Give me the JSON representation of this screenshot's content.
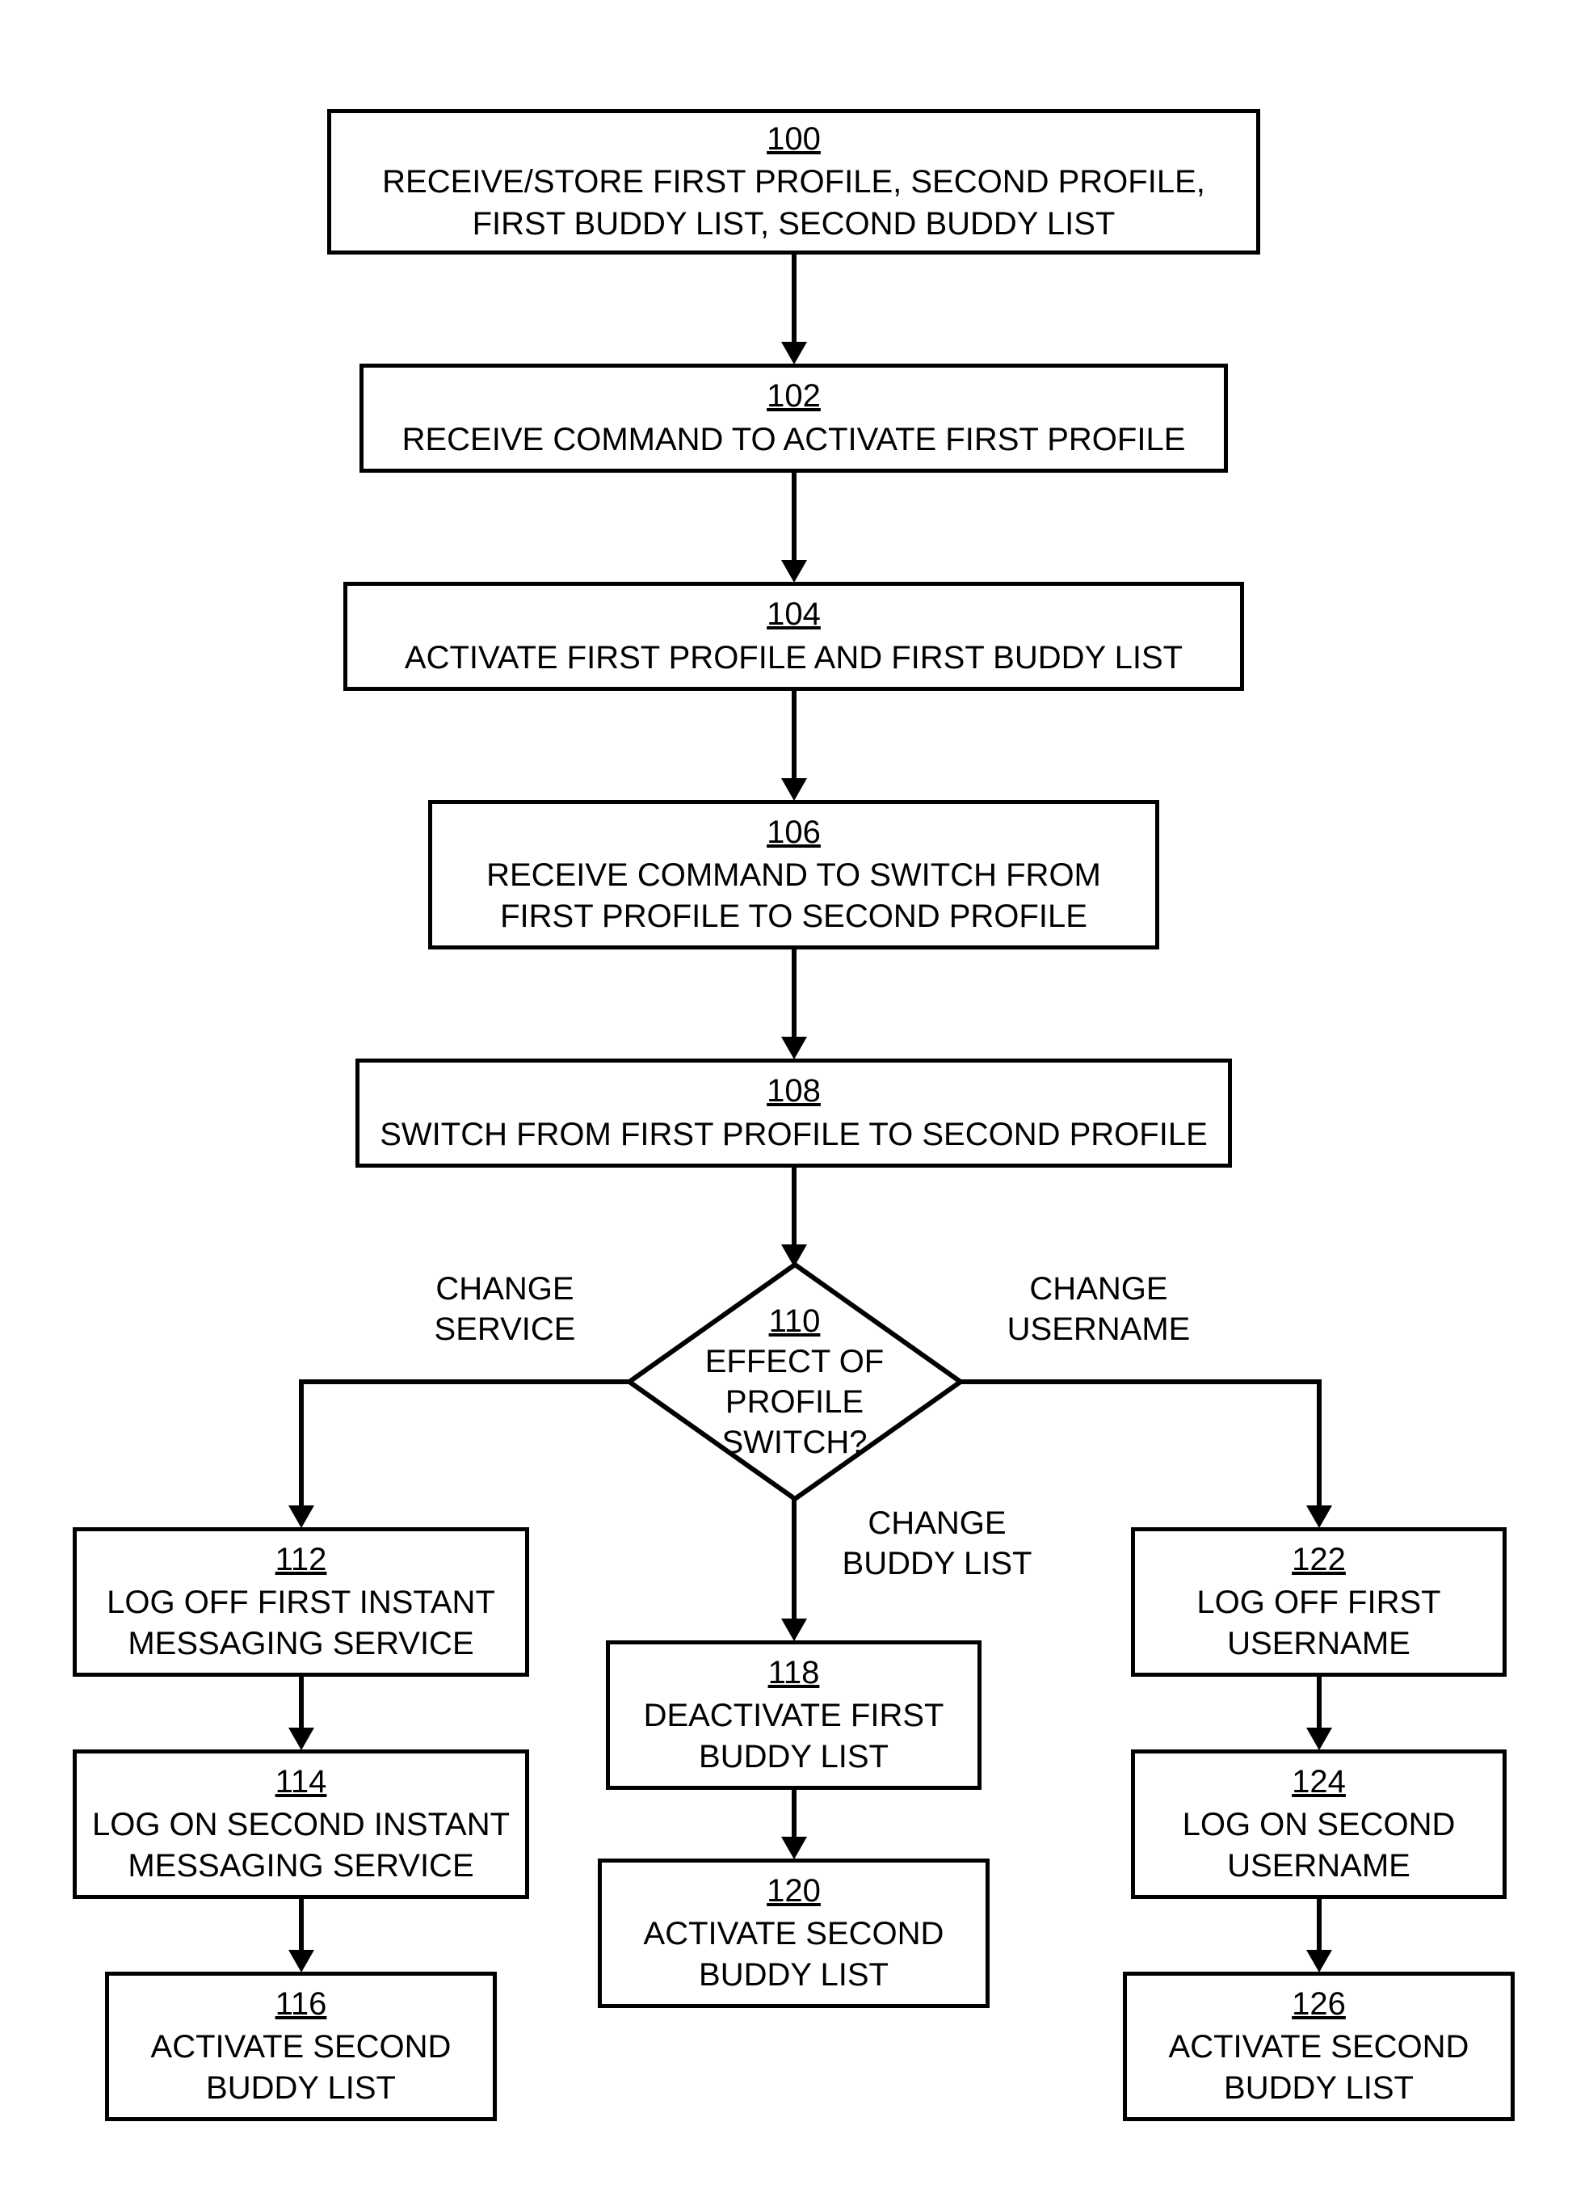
{
  "boxes": {
    "b100": {
      "num": "100",
      "text": "RECEIVE/STORE FIRST PROFILE, SECOND PROFILE,\nFIRST BUDDY LIST, SECOND BUDDY LIST"
    },
    "b102": {
      "num": "102",
      "text": "RECEIVE COMMAND TO ACTIVATE FIRST PROFILE"
    },
    "b104": {
      "num": "104",
      "text": "ACTIVATE FIRST PROFILE AND FIRST BUDDY LIST"
    },
    "b106": {
      "num": "106",
      "text": "RECEIVE COMMAND TO SWITCH FROM\nFIRST PROFILE TO SECOND PROFILE"
    },
    "b108": {
      "num": "108",
      "text": "SWITCH FROM FIRST PROFILE TO SECOND PROFILE"
    },
    "b110": {
      "num": "110",
      "text": "EFFECT OF\nPROFILE\nSWITCH?"
    },
    "b112": {
      "num": "112",
      "text": "LOG OFF FIRST INSTANT\nMESSAGING SERVICE"
    },
    "b114": {
      "num": "114",
      "text": "LOG ON SECOND INSTANT\nMESSAGING SERVICE"
    },
    "b116": {
      "num": "116",
      "text": "ACTIVATE SECOND\nBUDDY LIST"
    },
    "b118": {
      "num": "118",
      "text": "DEACTIVATE FIRST\nBUDDY LIST"
    },
    "b120": {
      "num": "120",
      "text": "ACTIVATE SECOND\nBUDDY LIST"
    },
    "b122": {
      "num": "122",
      "text": "LOG OFF FIRST\nUSERNAME"
    },
    "b124": {
      "num": "124",
      "text": "LOG ON SECOND\nUSERNAME"
    },
    "b126": {
      "num": "126",
      "text": "ACTIVATE SECOND\nBUDDY LIST"
    }
  },
  "labels": {
    "changeService": "CHANGE\nSERVICE",
    "changeUsername": "CHANGE\nUSERNAME",
    "changeBuddyList": "CHANGE\nBUDDY LIST"
  }
}
